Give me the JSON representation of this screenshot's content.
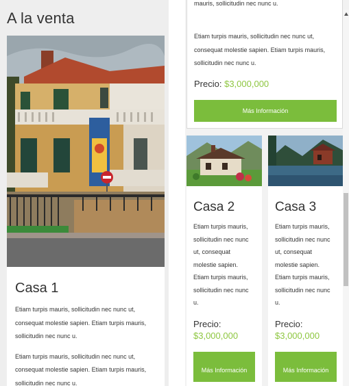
{
  "left_panel": {
    "heading": "A la venta",
    "card": {
      "title": "Casa 1",
      "description_1": "Etiam turpis mauris, sollicitudin nec nunc ut, consequat molestie sapien. Etiam turpis mauris, sollicitudin nec nunc u.",
      "description_2": "Etiam turpis mauris, sollicitudin nec nunc ut, consequat molestie sapien. Etiam turpis mauris, sollicitudin nec nunc u."
    }
  },
  "right_panel": {
    "top_card": {
      "description_tail": "mauris, sollicitudin nec nunc u.",
      "description": "Etiam turpis mauris, sollicitudin nec nunc ut, consequat molestie sapien. Etiam turpis mauris, sollicitudin nec nunc u.",
      "price_label": "Precio:",
      "price_value": "$3,000,000",
      "button_label": "Más Información"
    },
    "cards": [
      {
        "title": "Casa 2",
        "description": "Etiam turpis mauris, sollicitudin nec nunc ut, consequat molestie sapien. Etiam turpis mauris, sollicitudin nec nunc u.",
        "price_label": "Precio:",
        "price_value": "$3,000,000",
        "button_label": "Más Información"
      },
      {
        "title": "Casa 3",
        "description": "Etiam turpis mauris, sollicitudin nec nunc ut, consequat molestie sapien. Etiam turpis mauris, sollicitudin nec nunc u.",
        "price_label": "Precio:",
        "price_value": "$3,000,000",
        "button_label": "Más Información"
      }
    ]
  },
  "colors": {
    "accent_green": "#7bbd3c",
    "price_green": "#8dc63f"
  },
  "icons": {
    "scroll_up": "scroll-up-arrow-icon"
  }
}
